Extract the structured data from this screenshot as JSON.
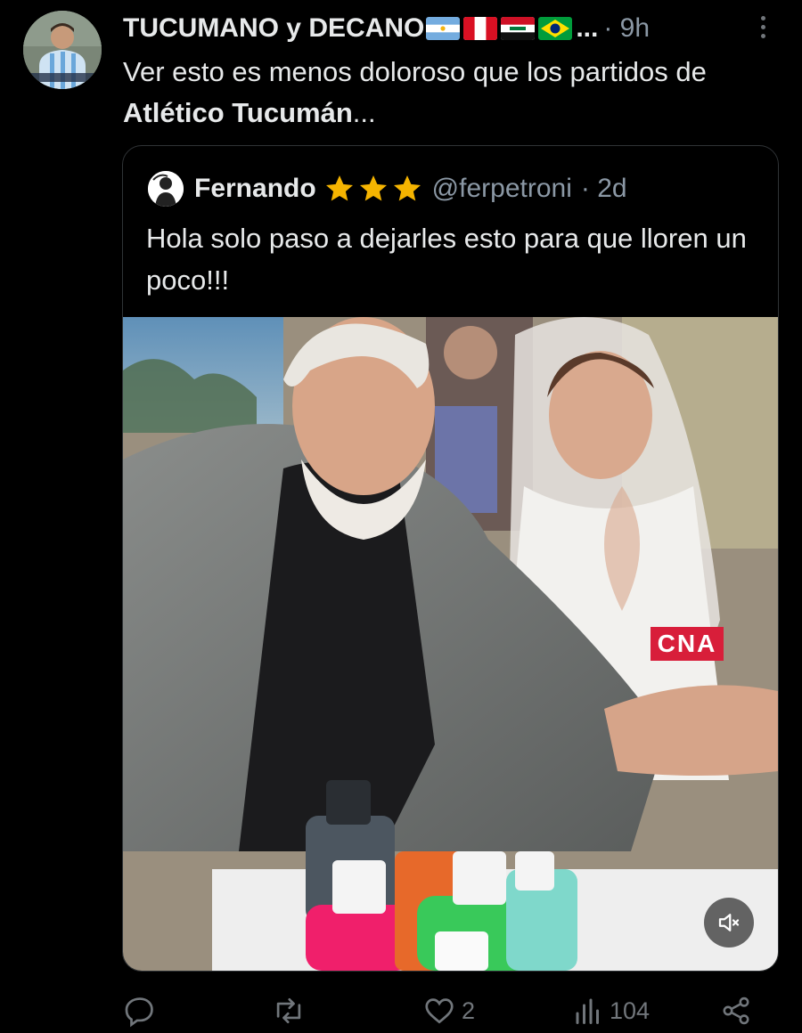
{
  "tweet": {
    "author_name": "TUCUMANO y DECANO",
    "ellipsis": "...",
    "time": "· 9h",
    "text_before": "Ver esto es menos doloroso que los partidos de ",
    "text_bold": "Atlético Tucumán",
    "text_after": "..."
  },
  "quoted": {
    "author_name": "Fernando",
    "handle": "@ferpetroni",
    "time": "· 2d",
    "text": "Hola solo paso a dejarles esto para que lloren un poco!!!",
    "stars_count": 3,
    "media": {
      "watermark": "CNA",
      "muted": true
    }
  },
  "actions": {
    "replies": "",
    "reposts": "",
    "likes": "2",
    "views": "104"
  },
  "colors": {
    "background": "#000000",
    "text": "#e7e9ea",
    "muted": "#71767b",
    "secondary": "#8b98a5",
    "star": "#f5b400",
    "watermark_bg": "#d81e3a"
  },
  "icons": [
    "avatar-image",
    "argentina-flag-icon",
    "peru-flag-icon",
    "iraq-flag-icon",
    "brazil-flag-icon",
    "more-options-icon",
    "star-icon",
    "mute-icon",
    "reply-icon",
    "repost-icon",
    "like-icon",
    "views-icon",
    "share-icon"
  ]
}
